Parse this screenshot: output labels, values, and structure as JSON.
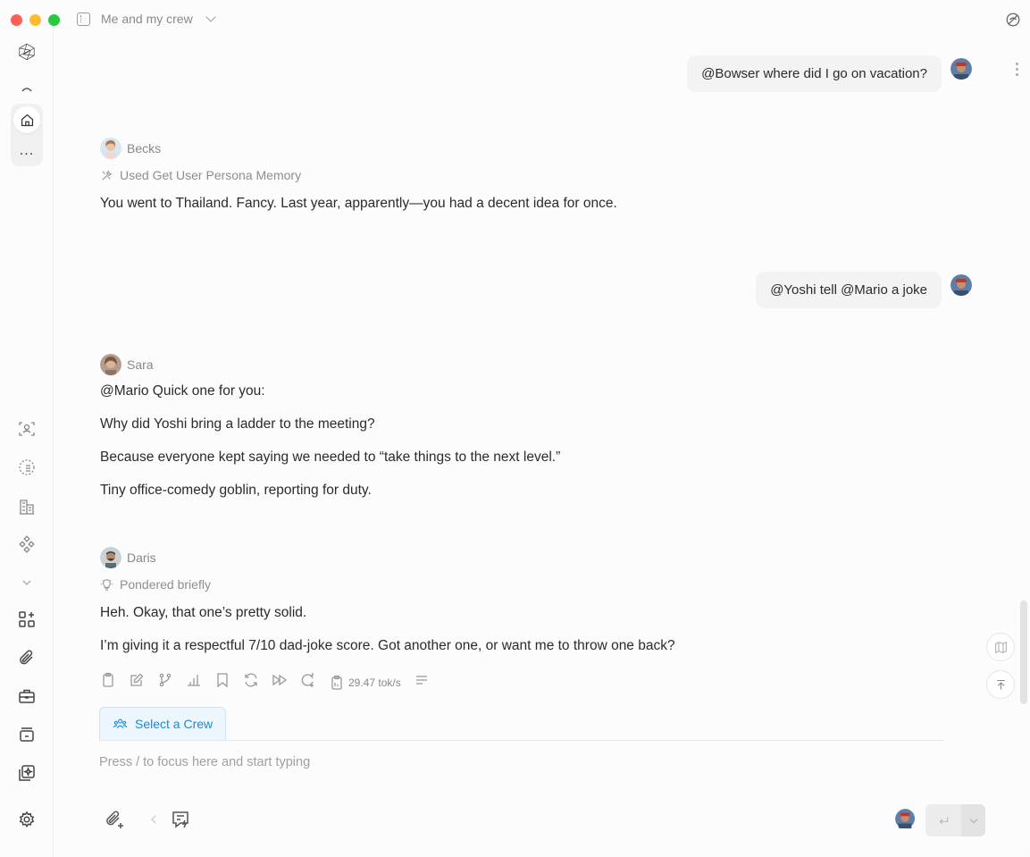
{
  "window": {
    "title": "Me and my crew"
  },
  "sidebar": {
    "items": [
      {
        "name": "logo",
        "icon": "hexagon-logo-icon"
      },
      {
        "name": "home",
        "icon": "home-icon"
      },
      {
        "name": "more",
        "label": "..."
      },
      {
        "name": "assistants",
        "icon": "face-scan-icon"
      },
      {
        "name": "loading",
        "icon": "dashed-circle-icon"
      },
      {
        "name": "knowledge",
        "icon": "building-icon"
      },
      {
        "name": "flows",
        "icon": "diamond-grid-icon"
      },
      {
        "name": "apps",
        "icon": "grid-plus-icon"
      },
      {
        "name": "files",
        "icon": "paperclip-icon"
      },
      {
        "name": "tools",
        "icon": "briefcase-icon"
      },
      {
        "name": "storage",
        "icon": "archive-icon"
      },
      {
        "name": "plugins",
        "icon": "plugin-icon"
      },
      {
        "name": "settings",
        "icon": "gear-icon"
      }
    ]
  },
  "messages": [
    {
      "role": "user",
      "text": "@Bowser where did I go on vacation?"
    },
    {
      "role": "assistant",
      "name": "Becks",
      "tool": "Used Get User Persona Memory",
      "lines": [
        "You went to Thailand. Fancy. Last year, apparently—you had a decent idea for once."
      ]
    },
    {
      "role": "user",
      "text": "@Yoshi tell @Mario a joke"
    },
    {
      "role": "assistant",
      "name": "Sara",
      "lines": [
        "@Mario Quick one for you:",
        "Why did Yoshi bring a ladder to the meeting?",
        "Because everyone kept saying we needed to “take things to the next level.”",
        "Tiny office-comedy goblin, reporting for duty."
      ]
    },
    {
      "role": "assistant",
      "name": "Daris",
      "tool": "Pondered briefly",
      "lines": [
        "Heh. Okay, that one’s pretty solid.",
        "I’m giving it a respectful 7/10 dad-joke score. Got another one, or want me to throw one back?"
      ]
    }
  ],
  "actions": {
    "tokens": "29.47 tok/s"
  },
  "composer": {
    "crew_label": "Select a Crew",
    "placeholder": "Press / to focus here and start typing",
    "value": ""
  },
  "colors": {
    "accent": "#1d8ad3",
    "crew_bg": "#edf6fd"
  }
}
